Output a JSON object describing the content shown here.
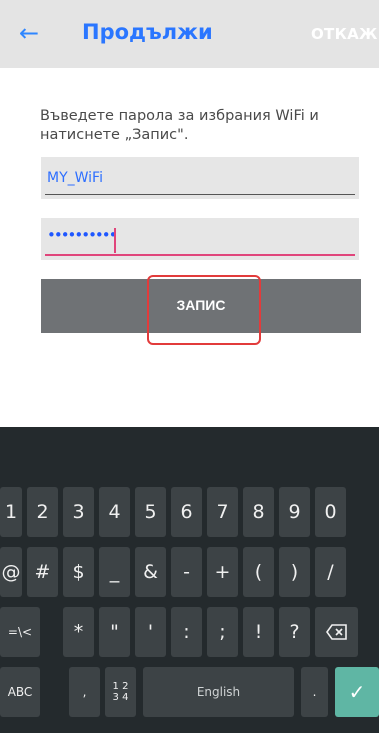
{
  "appbar": {
    "back_icon": "arrow-left-icon",
    "title": "Продължи",
    "cancel_label": "ОТКАЖИ"
  },
  "form": {
    "instructions": "Въведете парола за избрания WiFi и натиснете „Запис\".",
    "ssid_value": "MY_WiFi",
    "password_masked": "••••••••••",
    "save_label": "ЗАПИС"
  },
  "keyboard": {
    "row1": [
      "1",
      "2",
      "3",
      "4",
      "5",
      "6",
      "7",
      "8",
      "9",
      "0"
    ],
    "row2": [
      "@",
      "#",
      "$",
      "_",
      "&",
      "-",
      "+",
      "(",
      ")",
      "/"
    ],
    "row3": [
      "=\\<",
      "*",
      "\"",
      "'",
      ":",
      ";",
      "!",
      "?"
    ],
    "backspace_icon": "backspace-icon",
    "abc_label": "ABC",
    "comma_label": ",",
    "numpad_top": "1 2",
    "numpad_bottom": "3 4",
    "space_label": "English",
    "period_label": ".",
    "enter_icon": "check-icon"
  },
  "colors": {
    "accent": "#2a76ff",
    "highlight": "#e23b3b",
    "enter_key": "#5fb6a4"
  }
}
